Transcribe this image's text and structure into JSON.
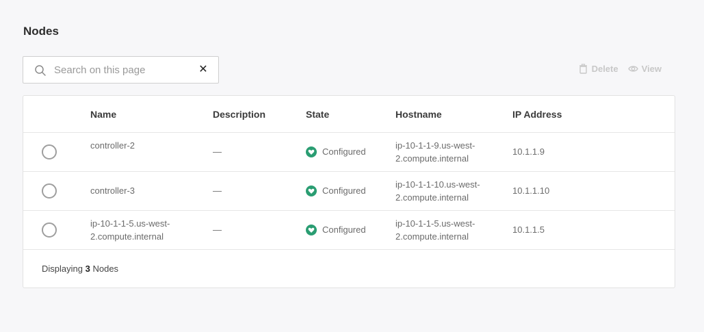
{
  "page": {
    "title": "Nodes"
  },
  "search": {
    "placeholder": "Search on this page",
    "value": ""
  },
  "toolbar": {
    "delete_label": "Delete",
    "view_label": "View"
  },
  "table": {
    "columns": [
      "Name",
      "Description",
      "State",
      "Hostname",
      "IP Address"
    ],
    "rows": [
      {
        "name": [
          "controller-2",
          ""
        ],
        "description": "—",
        "state": "Configured",
        "hostname": [
          "ip-10-1-1-9.us-west-",
          "2.compute.internal"
        ],
        "ip": "10.1.1.9"
      },
      {
        "name": [
          "controller-3",
          ""
        ],
        "description": "—",
        "state": "Configured",
        "hostname": [
          "ip-10-1-1-10.us-west-",
          "2.compute.internal"
        ],
        "ip": "10.1.1.10"
      },
      {
        "name": [
          "ip-10-1-1-5.us-west-",
          "2.compute.internal"
        ],
        "description": "—",
        "state": "Configured",
        "hostname": [
          "ip-10-1-1-5.us-west-",
          "2.compute.internal"
        ],
        "ip": "10.1.1.5"
      }
    ]
  },
  "footer": {
    "prefix": "Displaying",
    "count": "3",
    "suffix": "Nodes"
  },
  "colors": {
    "state_ok": "#2a9d72",
    "toolbar_disabled": "#c8c8c8"
  },
  "icons": {
    "search": "search-icon",
    "clear": "close-icon",
    "delete": "trash-icon",
    "view": "eye-icon",
    "state": "heart-icon"
  }
}
